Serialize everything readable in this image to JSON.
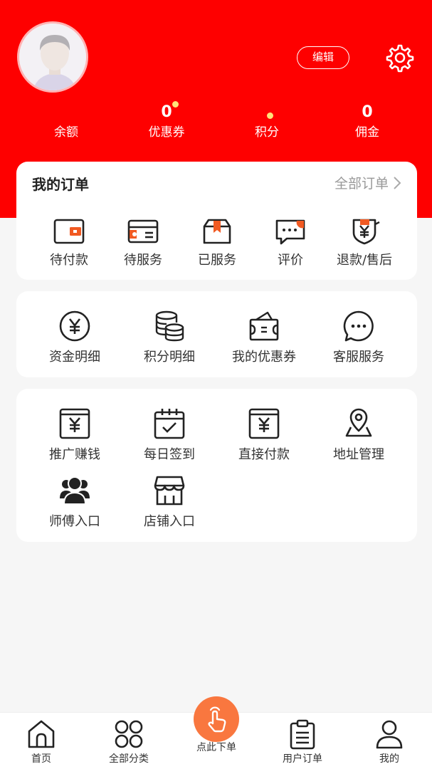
{
  "header": {
    "edit_label": "编辑",
    "stats": [
      {
        "value": "",
        "label": "余额"
      },
      {
        "value": "0",
        "label": "优惠券"
      },
      {
        "value": "",
        "label": "积分"
      },
      {
        "value": "0",
        "label": "佣金"
      }
    ]
  },
  "orders": {
    "title": "我的订单",
    "more_label": "全部订单",
    "items": [
      "待付款",
      "待服务",
      "已服务",
      "评价",
      "退款/售后"
    ]
  },
  "finance": {
    "items": [
      "资金明细",
      "积分明细",
      "我的优惠券",
      "客服服务"
    ]
  },
  "tools": {
    "items": [
      "推广赚钱",
      "每日签到",
      "直接付款",
      "地址管理",
      "师傅入口",
      "店铺入口"
    ]
  },
  "tabbar": {
    "items": [
      "首页",
      "全部分类",
      "点此下单",
      "用户订单",
      "我的"
    ]
  },
  "colors": {
    "brand_red": "#fe0000",
    "accent_orange": "#f9773f",
    "dot_yellow": "#ffe27a"
  }
}
